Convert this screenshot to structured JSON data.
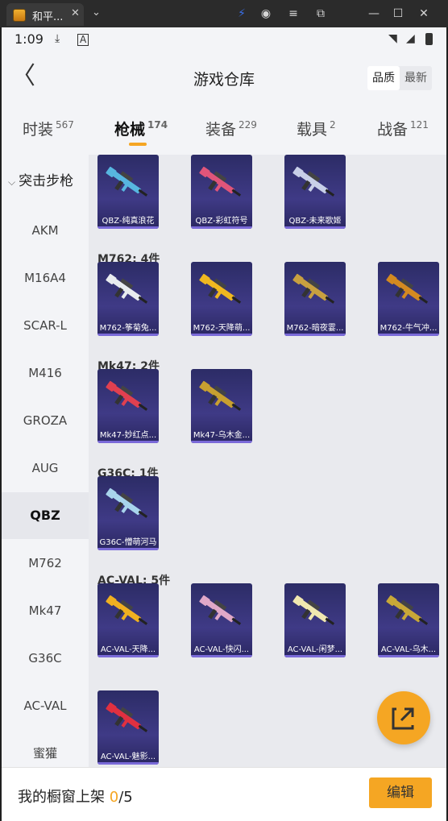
{
  "window": {
    "tab_title": "和平...",
    "tab_close": "✕",
    "dropdown": "⌄",
    "buttons": [
      {
        "name": "thunder-icon",
        "glyph": "⚡",
        "color": "#3a6fe8"
      },
      {
        "name": "account-icon",
        "glyph": "◉"
      },
      {
        "name": "menu-icon",
        "glyph": "≡"
      },
      {
        "name": "restore-icon",
        "glyph": "⧉"
      },
      {
        "name": "minimize-icon",
        "glyph": "—"
      },
      {
        "name": "maximize-icon",
        "glyph": "☐"
      },
      {
        "name": "close-icon",
        "glyph": "✕"
      }
    ]
  },
  "status": {
    "time": "1:09"
  },
  "header": {
    "back_icon": "〈",
    "title": "游戏仓库",
    "sort_options": [
      "品质",
      "最新"
    ]
  },
  "categories": [
    {
      "label": "时装",
      "count": "567"
    },
    {
      "label": "枪械",
      "count": "174"
    },
    {
      "label": "装备",
      "count": "229"
    },
    {
      "label": "载具",
      "count": "2"
    },
    {
      "label": "战备",
      "count": "121"
    }
  ],
  "sidebar": {
    "group": "突击步枪",
    "items": [
      "AKM",
      "M16A4",
      "SCAR-L",
      "M416",
      "GROZA",
      "AUG",
      "QBZ",
      "M762",
      "Mk47",
      "G36C",
      "AC-VAL",
      "蜜獾"
    ],
    "active": "QBZ"
  },
  "groups": [
    {
      "title": "",
      "items": [
        "QBZ-纯真浪花",
        "QBZ-彩虹符号",
        "QBZ-未来歌姬"
      ],
      "colors": [
        "#57b6e0",
        "#e0557a",
        "#c8cfe8"
      ]
    },
    {
      "title": "M762: 4件",
      "items": [
        "M762-筝菊兔...",
        "M762-天降萌...",
        "M762-暗夜霎...",
        "M762-牛气冲..."
      ],
      "colors": [
        "#e8ecef",
        "#f0b820",
        "#c8a040",
        "#d48a20"
      ]
    },
    {
      "title": "Mk47: 2件",
      "items": [
        "Mk47-妙红点...",
        "Mk47-乌木金..."
      ],
      "colors": [
        "#e04050",
        "#c8a030"
      ]
    },
    {
      "title": "G36C: 1件",
      "items": [
        "G36C-懵萌河马"
      ],
      "colors": [
        "#a8d4ec"
      ]
    },
    {
      "title": "AC-VAL: 5件",
      "items": [
        "AC-VAL-天降...",
        "AC-VAL-快闪...",
        "AC-VAL-闲梦...",
        "AC-VAL-乌木...",
        "AC-VAL-魅影..."
      ],
      "colors": [
        "#f0b020",
        "#e0a8c8",
        "#f0e8b0",
        "#c8a838",
        "#e03040"
      ]
    }
  ],
  "bottom": {
    "showcase_label": "我的橱窗上架",
    "showcase_count": "0",
    "showcase_total": "/5",
    "edit_label": "编辑"
  },
  "colors": {
    "accent": "#f5a623",
    "card_bg": "#2c2c66",
    "card_bar": "#7a6ad8"
  }
}
